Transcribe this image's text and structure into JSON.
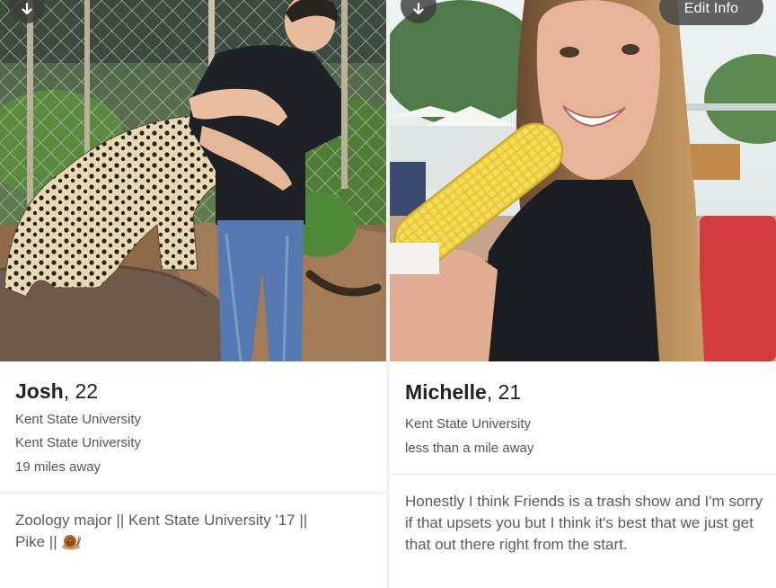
{
  "profiles": [
    {
      "name": "Josh",
      "age": ", 22",
      "lines": [
        "Kent State University",
        "Kent State University",
        "19 miles away"
      ],
      "bio": "Zoology major || Kent State University '17 ||",
      "bio_line2": "Pike ||",
      "bio_emoji": "snail-icon",
      "photo_alt": "Man hugging a leopard in a fenced enclosure"
    },
    {
      "name": "Michelle",
      "age": ", 21",
      "lines": [
        "Kent State University",
        "less than a mile away"
      ],
      "bio": "Honestly I think Friends is a trash show and I'm sorry if that upsets you but I think it's best that we just get that out there right from the start.",
      "photo_alt": "Woman holding a corn on the cob"
    }
  ],
  "toolbar": {
    "edit_info_label": "Edit Info"
  },
  "icons": {
    "left_button": "arrow-down-icon",
    "right_button": "arrow-down-icon"
  },
  "colors": {
    "button_bg": "#464646",
    "name_text": "#222222",
    "meta_text": "#555555",
    "separator": "#e3e3e3"
  }
}
